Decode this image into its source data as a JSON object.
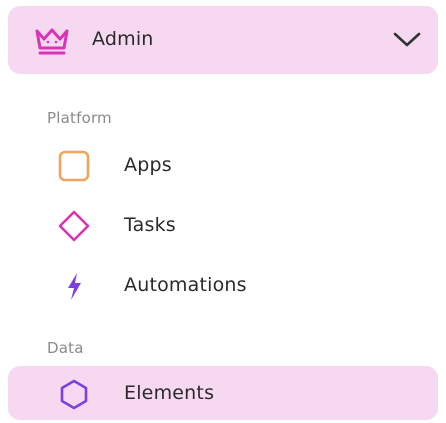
{
  "header": {
    "label": "Admin",
    "icon": "crown-icon",
    "expand_icon": "chevron-down-icon"
  },
  "sections": [
    {
      "label": "Platform",
      "items": [
        {
          "label": "Apps",
          "icon": "square-icon",
          "color": "#f0a55c"
        },
        {
          "label": "Tasks",
          "icon": "diamond-icon",
          "color": "#d834b4"
        },
        {
          "label": "Automations",
          "icon": "lightning-icon",
          "color": "#7c3fe0"
        }
      ]
    },
    {
      "label": "Data",
      "items": [
        {
          "label": "Elements",
          "icon": "hexagon-icon",
          "color": "#7c3fe0",
          "active": true
        }
      ]
    }
  ],
  "colors": {
    "highlight": "#f6d9f1",
    "text": "#2a2a2a",
    "section_text": "#8a8a8a",
    "crown": "#d834b4"
  }
}
